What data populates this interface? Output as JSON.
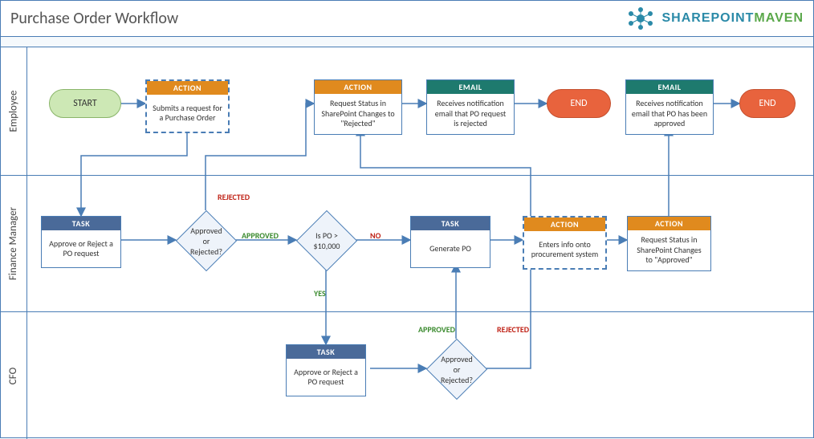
{
  "title": "Purchase Order Workflow",
  "logo": {
    "brand1": "SHAREP",
    "brand2": "O",
    "brand3": "INT",
    "brand4": "MAVEN"
  },
  "lanes": {
    "employee": "Employee",
    "finance": "Finance Manager",
    "cfo": "CFO"
  },
  "nodes": {
    "start": {
      "label": "START"
    },
    "submit": {
      "head": "ACTION",
      "body": "Submits a request for a Purchase Order"
    },
    "status_rej": {
      "head": "ACTION",
      "body": "Request Status in SharePoint Changes to \"Rejected\""
    },
    "email_rej": {
      "head": "EMAIL",
      "body": "Receives notification email that PO request is rejected"
    },
    "end1": {
      "label": "END"
    },
    "email_appr": {
      "head": "EMAIL",
      "body": "Receives notification email that PO has been approved"
    },
    "end2": {
      "label": "END"
    },
    "task_fm": {
      "head": "TASK",
      "body": "Approve or Reject a PO request"
    },
    "dec_fm": {
      "label": "Approved or Rejected?"
    },
    "dec_amt": {
      "label": "Is PO > $10,000"
    },
    "task_gen": {
      "head": "TASK",
      "body": "Generate PO"
    },
    "enter_info": {
      "head": "ACTION",
      "body": "Enters info onto procurement system"
    },
    "status_appr": {
      "head": "ACTION",
      "body": "Request Status in SharePoint Changes to \"Approved\""
    },
    "task_cfo": {
      "head": "TASK",
      "body": "Approve or Reject a PO request"
    },
    "dec_cfo": {
      "label": "Approved or Rejected?"
    }
  },
  "edge_labels": {
    "fm_rejected": "REJECTED",
    "fm_approved": "APPROVED",
    "amt_yes": "YES",
    "amt_no": "NO",
    "cfo_approved": "APPROVED",
    "cfo_rejected": "REJECTED"
  }
}
